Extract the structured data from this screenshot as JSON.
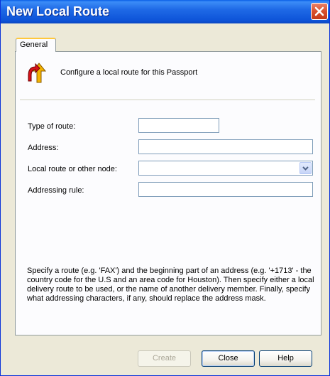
{
  "window": {
    "title": "New Local Route"
  },
  "tabs": [
    {
      "label": "General"
    }
  ],
  "header": {
    "text": "Configure a local route for this Passport",
    "icon": "route-arrows-icon"
  },
  "form": {
    "type_of_route": {
      "label": "Type of route:",
      "value": ""
    },
    "address": {
      "label": "Address:",
      "value": ""
    },
    "local_route": {
      "label": "Local route or other node:",
      "value": ""
    },
    "addressing_rule": {
      "label": "Addressing rule:",
      "value": ""
    }
  },
  "description": "Specify a route (e.g. 'FAX') and the beginning part of an address (e.g. '+1713' - the country code for the U.S and an area code for Houston). Then specify either a local delivery route to be used, or the name of another delivery member.  Finally, specify what addressing characters, if any, should replace the address mask.",
  "buttons": {
    "create": "Create",
    "close": "Close",
    "help": "Help"
  },
  "colors": {
    "titlebar": "#0d53d8",
    "close": "#d9502c",
    "panel": "#fcfcfe",
    "dialog": "#ece9d8"
  }
}
